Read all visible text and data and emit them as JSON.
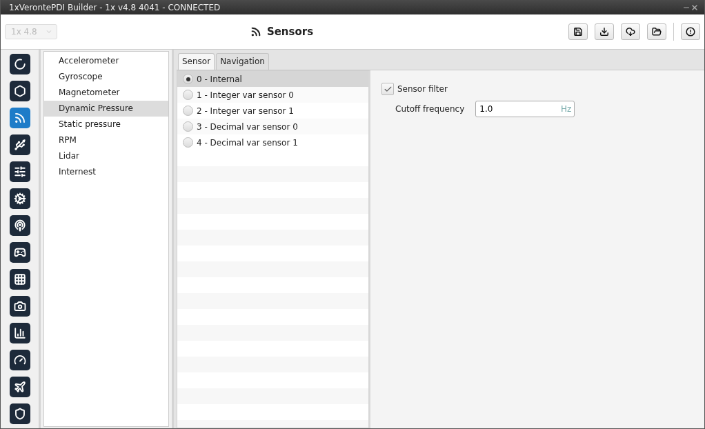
{
  "window": {
    "title": "1xVerontePDI Builder - 1x v4.8 4041 - CONNECTED"
  },
  "header": {
    "version_select": {
      "value": "1x 4.8",
      "disabled": true
    },
    "title": "Sensors",
    "toolbar_buttons": [
      {
        "kind": "save"
      },
      {
        "kind": "download"
      },
      {
        "kind": "cloud"
      },
      {
        "kind": "folder"
      },
      {
        "kind": "alert"
      }
    ]
  },
  "rail": [
    {
      "selected": false
    },
    {
      "selected": false
    },
    {
      "selected": true
    },
    {
      "selected": false
    },
    {
      "selected": false
    },
    {
      "selected": false
    },
    {
      "selected": false
    },
    {
      "selected": false
    },
    {
      "selected": false
    },
    {
      "selected": false
    },
    {
      "selected": false
    },
    {
      "selected": false
    },
    {
      "selected": false
    },
    {
      "selected": false
    }
  ],
  "sidebar": {
    "items": [
      {
        "label": "Accelerometer",
        "selected": false
      },
      {
        "label": "Gyroscope",
        "selected": false
      },
      {
        "label": "Magnetometer",
        "selected": false
      },
      {
        "label": "Dynamic Pressure",
        "selected": true
      },
      {
        "label": "Static pressure",
        "selected": false
      },
      {
        "label": "RPM",
        "selected": false
      },
      {
        "label": "Lidar",
        "selected": false
      },
      {
        "label": "Internest",
        "selected": false
      }
    ]
  },
  "tabs": [
    {
      "label": "Sensor",
      "selected": true
    },
    {
      "label": "Navigation",
      "selected": false
    }
  ],
  "sources": [
    {
      "label": "0 - Internal",
      "selected": true
    },
    {
      "label": "1 - Integer var sensor 0",
      "selected": false
    },
    {
      "label": "2 - Integer var sensor 1",
      "selected": false
    },
    {
      "label": "3 - Decimal var sensor 0",
      "selected": false
    },
    {
      "label": "4 - Decimal var sensor 1",
      "selected": false
    }
  ],
  "settings": {
    "sensor_filter": {
      "label": "Sensor filter",
      "checked": true
    },
    "cutoff": {
      "label": "Cutoff frequency",
      "value": "1.0",
      "unit": "Hz"
    }
  }
}
